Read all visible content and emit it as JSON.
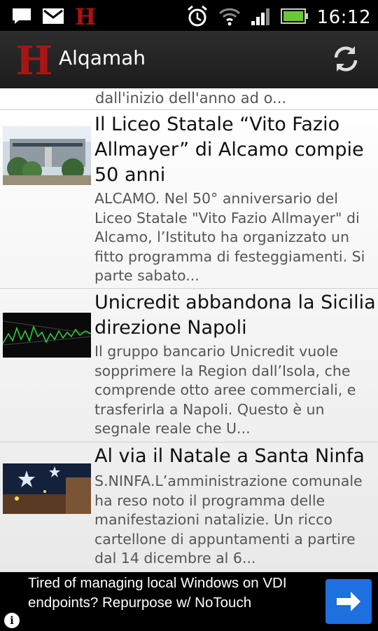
{
  "status_bar": {
    "time": "16:12",
    "icons": [
      "chat-icon",
      "gmail-icon",
      "h-app-icon",
      "alarm-icon",
      "wifi-icon",
      "signal-icon",
      "battery-icon"
    ]
  },
  "app_bar": {
    "logo_letter": "H",
    "title": "Alqamah",
    "refresh_icon": "refresh-icon"
  },
  "feed": {
    "partial_summary": "dall'inizio dell'anno ad o...",
    "items": [
      {
        "title": "Il Liceo Statale “Vito Fazio Allmayer” di Alcamo compie 50 anni",
        "summary": "ALCAMO. Nel 50° anniversario del Liceo Statale \"Vito Fazio Allmayer\" di Alcamo, l’Istituto ha organizzato un fitto programma di festeggiamenti. Si parte sabato..."
      },
      {
        "title": "Unicredit abbandona la Sicilia direzione Napoli",
        "summary": "Il gruppo bancario Unicredit vuole sopprimere la Region dall’Isola, che comprende otto aree commerciali, e trasferirla a Napoli. Questo è un segnale reale che U..."
      },
      {
        "title": "Al via il Natale a Santa Ninfa",
        "summary": "S.NINFA.L’amministrazione comunale ha reso noto  il programma delle manifestazioni natalizie. Un ricco cartellone di appuntamenti a partire dal 14 dicembre al 6..."
      }
    ]
  },
  "ad": {
    "text": "Tired of managing local Windows on VDI endpoints? Repurpose w/ NoTouch",
    "info_glyph": "i",
    "arrow_color": "#1e6fe0"
  }
}
